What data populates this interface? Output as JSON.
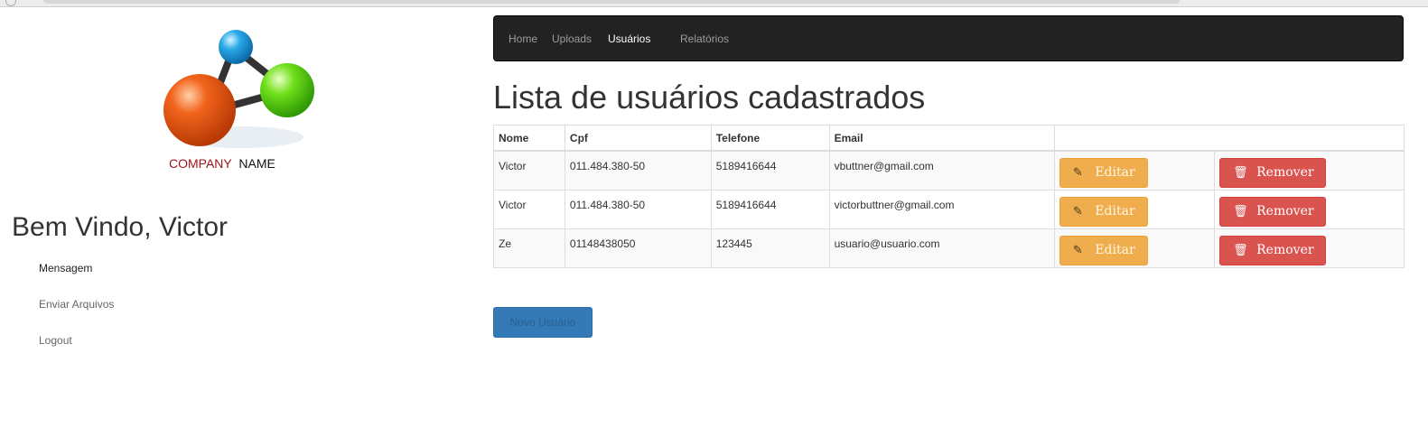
{
  "logo": {
    "company": "COMPANY",
    "name": "NAME"
  },
  "welcome": "Bem Vindo, Victor",
  "side_nav": [
    {
      "label": "Mensagem"
    },
    {
      "label": "Enviar Arquivos"
    },
    {
      "label": "Logout"
    }
  ],
  "navbar": {
    "items": [
      {
        "label": "Home"
      },
      {
        "label": "Uploads"
      },
      {
        "label": "Usuários"
      },
      {
        "label": "Relatórios"
      }
    ]
  },
  "page_title": "Lista de usuários cadastrados",
  "table": {
    "headers": [
      "Nome",
      "Cpf",
      "Telefone",
      "Email",
      ""
    ],
    "rows": [
      {
        "nome": "Victor",
        "cpf": "011.484.380-50",
        "telefone": "5189416644",
        "email": "vbuttner@gmail.com"
      },
      {
        "nome": "Victor",
        "cpf": "011.484.380-50",
        "telefone": "5189416644",
        "email": "victorbuttner@gmail.com"
      },
      {
        "nome": "Ze",
        "cpf": "01148438050",
        "telefone": "123445",
        "email": "usuario@usuario.com"
      }
    ],
    "edit_label": "Editar",
    "remove_label": "Remover"
  },
  "new_user_button": "Novo Usuário",
  "icons": {
    "edit": "edit-icon",
    "remove": "trash-icon"
  },
  "colors": {
    "navbar": "#222222",
    "edit": "#f0ad4e",
    "remove": "#d9534f",
    "primary": "#337ab7"
  }
}
